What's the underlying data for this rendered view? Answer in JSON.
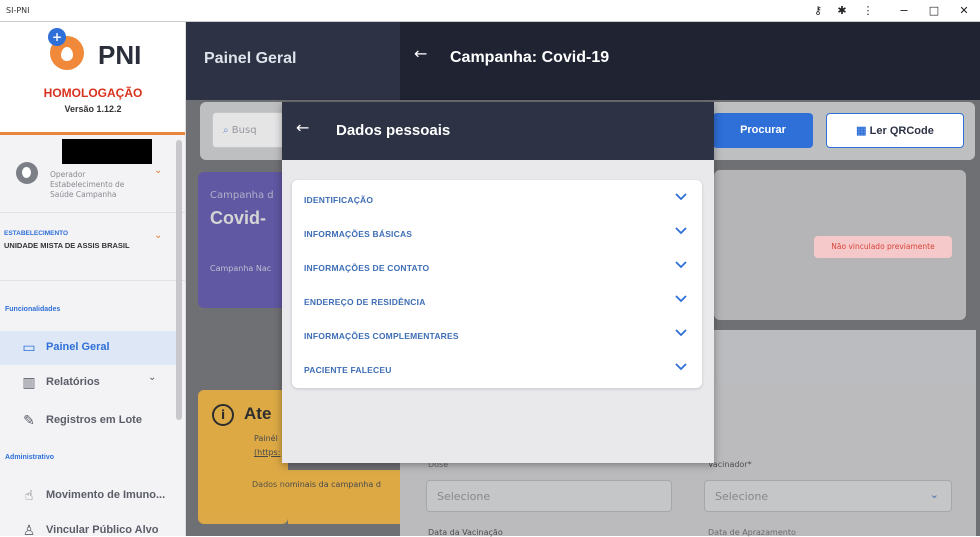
{
  "window": {
    "title": "SI-PNI",
    "controls": [
      "−",
      "□",
      "✕"
    ]
  },
  "sidebar": {
    "brand": "PNI",
    "env": "HOMOLOGAÇÃO",
    "version": "Versão 1.12.2",
    "operator": {
      "role": "Operador",
      "place": "Estabelecimento de Saúde Campanha"
    },
    "establishment": {
      "label": "ESTABELECIMENTO",
      "value": "UNIDADE MISTA DE ASSIS BRASIL"
    },
    "section_func": "Funcionalidades",
    "items": [
      {
        "label": "Painel Geral",
        "icon": "monitor-icon",
        "active": true
      },
      {
        "label": "Relatórios",
        "icon": "bar-chart-icon",
        "active": false
      },
      {
        "label": "Registros em Lote",
        "icon": "syringe-icon",
        "active": false
      }
    ],
    "section_admin": "Administrativo",
    "admin_items": [
      {
        "label": "Movimento de Imuno...",
        "icon": "hand-icon"
      },
      {
        "label": "Vincular Público Alvo",
        "icon": "user-icon"
      }
    ]
  },
  "header": {
    "left_title": "Painel Geral",
    "right_title": "Campanha: Covid-19"
  },
  "search": {
    "placeholder": "Busq",
    "search_button": "Procurar",
    "qr_button": "Ler QRCode"
  },
  "campaign": {
    "label": "Campanha d",
    "name": "Covid-",
    "desc": "Campanha Nac"
  },
  "status_badge": "Não vinculado previamente",
  "attention": {
    "title": "Ate",
    "text": "Painél",
    "link": "(https:",
    "footer": "Dados nominais da campanha d"
  },
  "form": {
    "dose_label": "Dose",
    "dose_value": "Selecione",
    "vaccinator_label": "Vacinador*",
    "vaccinator_value": "Selecione",
    "date_label": "Data da Vacinação",
    "date2_label": "Data de Aprazamento"
  },
  "modal": {
    "title": "Dados pessoais",
    "sections": [
      "IDENTIFICAÇÃO",
      "INFORMAÇÕES BÁSICAS",
      "INFORMAÇÕES DE CONTATO",
      "ENDEREÇO DE RESIDÊNCIA",
      "INFORMAÇÕES COMPLEMENTARES",
      "PACIENTE FALECEU"
    ]
  },
  "colors": {
    "primary": "#2e6fd8",
    "header_dark": "#2d3344",
    "accent_orange": "#e9863b",
    "danger": "#d9443b"
  }
}
